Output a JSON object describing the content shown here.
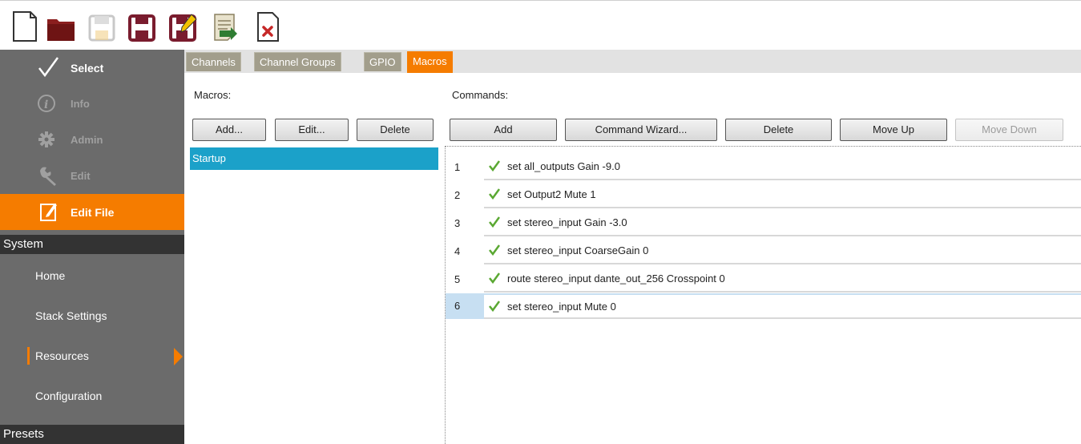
{
  "toolbar": {
    "buttons": [
      {
        "icon": "new-file-icon"
      },
      {
        "icon": "open-folder-icon"
      },
      {
        "icon": "save-disabled-icon"
      },
      {
        "icon": "save-icon"
      },
      {
        "icon": "save-as-icon"
      },
      {
        "icon": "script-icon"
      },
      {
        "icon": "close-file-icon"
      }
    ]
  },
  "sidebar": {
    "nav": [
      {
        "label": "Select",
        "icon": "checkmark-icon"
      },
      {
        "label": "Info",
        "icon": "info-icon"
      },
      {
        "label": "Admin",
        "icon": "gear-icon"
      },
      {
        "label": "Edit",
        "icon": "wrench-icon"
      },
      {
        "label": "Edit File",
        "icon": "edit-file-icon"
      }
    ],
    "system_header": "System",
    "system_items": [
      {
        "label": "Home"
      },
      {
        "label": "Stack Settings"
      },
      {
        "label": "Resources"
      },
      {
        "label": "Configuration"
      }
    ],
    "presets_header": "Presets"
  },
  "tabs": [
    {
      "label": "Channels"
    },
    {
      "label": "Channel Groups"
    },
    {
      "label": "GPIO"
    },
    {
      "label": "Macros"
    }
  ],
  "macros": {
    "label": "Macros:",
    "add_label": "Add...",
    "edit_label": "Edit...",
    "delete_label": "Delete",
    "items": [
      "Startup"
    ]
  },
  "commands": {
    "label": "Commands:",
    "add_label": "Add",
    "wizard_label": "Command Wizard...",
    "delete_label": "Delete",
    "move_up_label": "Move Up",
    "move_down_label": "Move Down",
    "rows": [
      {
        "num": "1",
        "text": "set all_outputs Gain -9.0"
      },
      {
        "num": "2",
        "text": "set Output2 Mute  1"
      },
      {
        "num": "3",
        "text": "set stereo_input Gain -3.0"
      },
      {
        "num": "4",
        "text": "set stereo_input CoarseGain  0"
      },
      {
        "num": "5",
        "text": "route stereo_input dante_out_256 Crosspoint  0"
      },
      {
        "num": "6",
        "text": "set stereo_input Mute  0"
      }
    ]
  },
  "colors": {
    "accent": "#f57c00",
    "selection": "#1ba1c9",
    "sidebar": "#6b6b6b"
  }
}
